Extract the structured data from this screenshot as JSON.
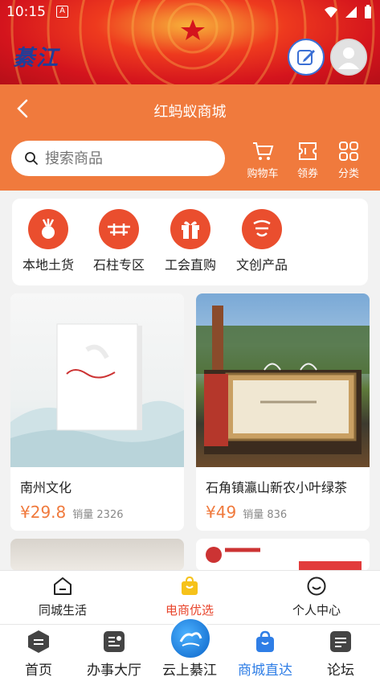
{
  "status_bar": {
    "time": "10:15",
    "notification_badge": "A"
  },
  "banner": {
    "logo_text": "綦江"
  },
  "header": {
    "title": "红蚂蚁商城",
    "search_placeholder": "搜索商品",
    "actions": [
      {
        "label": "购物车",
        "icon": "cart-icon"
      },
      {
        "label": "领券",
        "icon": "coupon-icon"
      },
      {
        "label": "分类",
        "icon": "category-icon"
      }
    ]
  },
  "categories": [
    {
      "label": "本地土货",
      "icon": "radish-icon"
    },
    {
      "label": "石柱专区",
      "icon": "shizhu-logo-icon"
    },
    {
      "label": "工会直购",
      "icon": "gift-icon"
    },
    {
      "label": "文创产品",
      "icon": "culture-icon"
    }
  ],
  "products": [
    {
      "name": "南州文化",
      "price": "¥29.8",
      "sales": "销量 2326"
    },
    {
      "name": "石角镇瀛山新农小叶绿茶",
      "price": "¥49",
      "sales": "销量 836"
    }
  ],
  "subtabs": [
    {
      "label": "同城生活",
      "icon": "home-icon"
    },
    {
      "label": "电商优选",
      "icon": "shopping-bag-icon"
    },
    {
      "label": "个人中心",
      "icon": "smile-icon"
    }
  ],
  "bottom_tabs": [
    {
      "label": "首页",
      "icon": "home-hex-icon"
    },
    {
      "label": "办事大厅",
      "icon": "service-hall-icon"
    },
    {
      "label": "云上綦江",
      "icon": "cloud-qijiang-logo"
    },
    {
      "label": "商城直达",
      "icon": "mall-bag-icon"
    },
    {
      "label": "论坛",
      "icon": "forum-icon"
    }
  ],
  "colors": {
    "accent": "#f07a3d",
    "red": "#ea4e2e",
    "active_blue": "#2f7ee6"
  }
}
